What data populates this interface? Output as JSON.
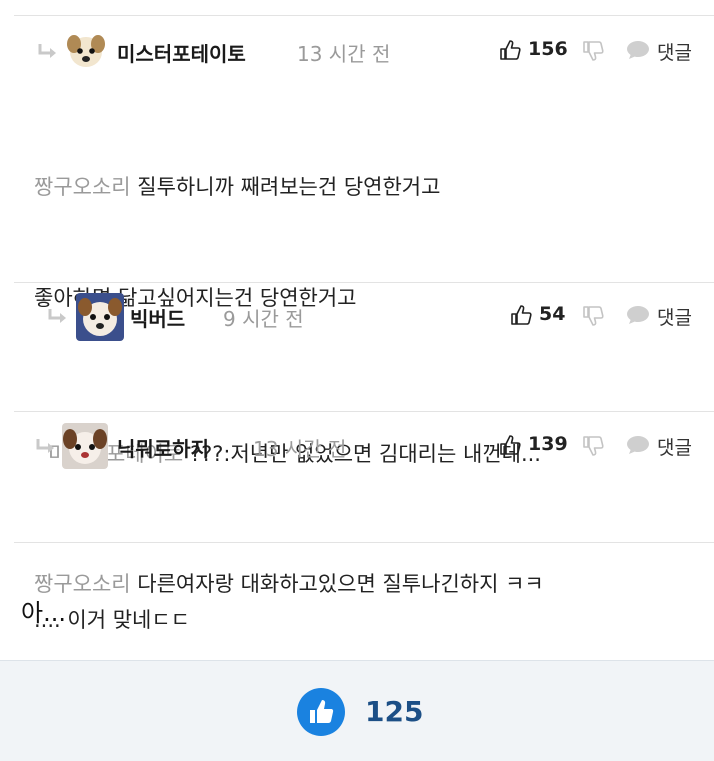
{
  "comments": [
    {
      "author": "미스터포테이토",
      "time": "13 시간 전",
      "likes": "156",
      "reply_label": "댓글",
      "mention": "짱구오소리",
      "lines": [
        "질투하니까 째려보는건 당연한거고",
        "좋아하면 닮고싶어지는건 당연한거고",
        "",
        "",
        ".... 이거 맞네ㄷㄷ"
      ]
    },
    {
      "author": "빅버드",
      "time": "9 시간 전",
      "likes": "54",
      "reply_label": "댓글",
      "mention": "미스터포테이토",
      "lines": [
        "???:저년만 없었으면 김대리는 내껀데..."
      ]
    },
    {
      "author": "닉뭐로하지",
      "time": "13 시간 전",
      "likes": "139",
      "reply_label": "댓글",
      "mention": "짱구오소리",
      "lines": [
        "다른여자랑 대화하고있으면 질투나긴하지 ㅋㅋ"
      ]
    }
  ],
  "aside_text": "아...",
  "footer": {
    "like_count": "125"
  },
  "colors": {
    "accent": "#1a82e0",
    "count": "#1c4f86",
    "muted": "#9a9a9a"
  },
  "icons": [
    "reply-arrow-icon",
    "thumbs-up-icon",
    "thumbs-down-icon",
    "speech-bubble-icon"
  ]
}
